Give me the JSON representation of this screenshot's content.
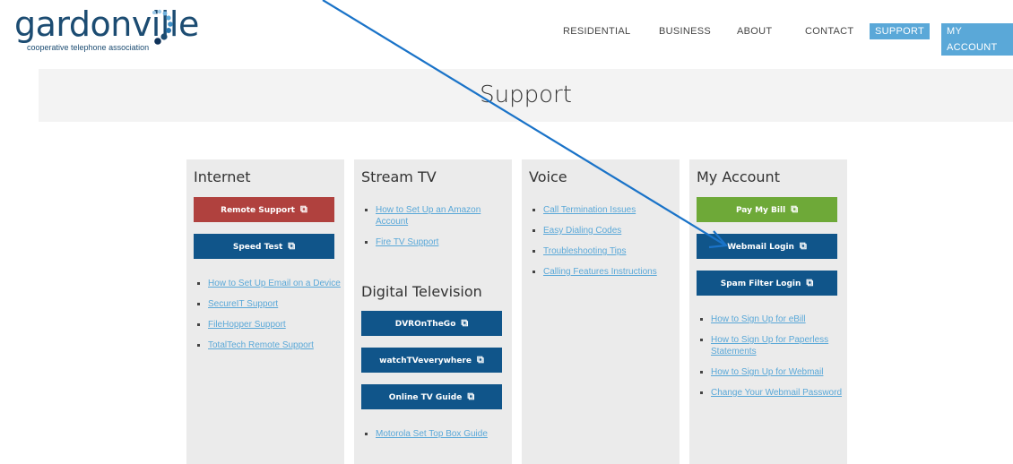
{
  "logo": {
    "word": "gardonville",
    "tagline": "cooperative telephone association"
  },
  "nav": {
    "residential": "RESIDENTIAL",
    "business": "BUSINESS",
    "about": "ABOUT",
    "contact": "CONTACT",
    "support": "SUPPORT",
    "my_account": "MY ACCOUNT"
  },
  "hero": {
    "title": "Support"
  },
  "internet": {
    "title": "Internet",
    "remote_support": "Remote Support",
    "speed_test": "Speed Test",
    "links": [
      "How to Set Up Email on a Device",
      "SecureIT Support",
      "FileHopper Support",
      "TotalTech Remote Support"
    ]
  },
  "stream": {
    "title": "Stream TV",
    "links": [
      "How to Set Up an Amazon Account",
      "Fire TV Support"
    ],
    "digital_title": "Digital Television",
    "dvr": "DVROnTheGo",
    "watchtv": "watchTVeverywhere",
    "guide": "Online TV Guide",
    "links2": [
      "Motorola Set Top Box Guide"
    ]
  },
  "voice": {
    "title": "Voice",
    "links": [
      "Call Termination Issues",
      "Easy Dialing Codes",
      "Troubleshooting Tips",
      "Calling Features Instructions"
    ]
  },
  "account": {
    "title": "My Account",
    "pay": "Pay My Bill",
    "webmail": "Webmail Login",
    "spam": "Spam Filter Login",
    "links": [
      "How to Sign Up for eBill",
      "How to Sign Up for Paperless Statements",
      "How to Sign Up for Webmail",
      "Change Your Webmail Password"
    ]
  },
  "colors": {
    "brand": "#1c4c72",
    "accent": "#5aa8d8",
    "button_blue": "#10558a",
    "button_red": "#b0413e",
    "button_green": "#6ea938"
  }
}
